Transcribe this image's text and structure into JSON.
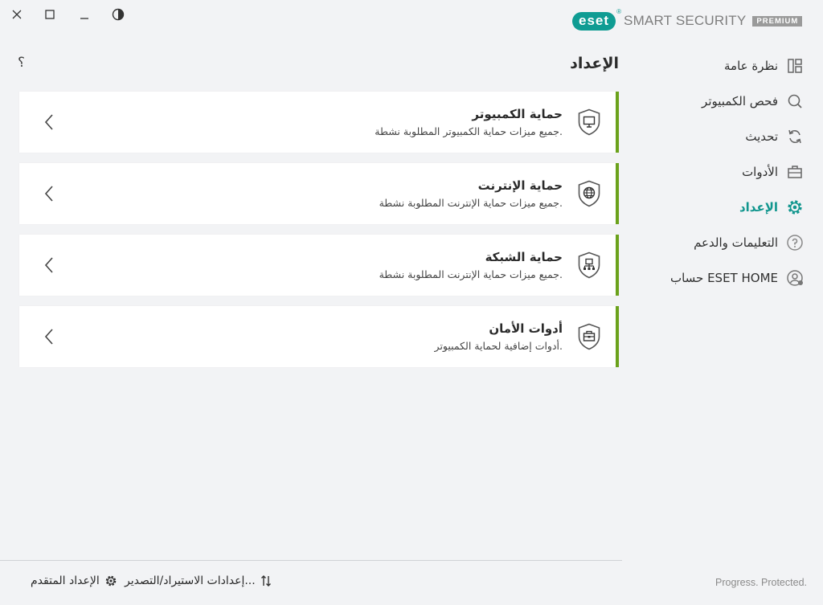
{
  "window": {
    "close_label": "close",
    "maximize_label": "maximize",
    "minimize_label": "minimize",
    "theme_label": "theme"
  },
  "brand": {
    "logo_text": "eset",
    "product": "SMART SECURITY",
    "edition": "PREMIUM",
    "accent_color": "#0f9c93"
  },
  "sidebar": {
    "items": [
      {
        "label": "نظرة عامة",
        "icon": "dashboard-icon"
      },
      {
        "label": "فحص الكمبيوتر",
        "icon": "search-icon"
      },
      {
        "label": "تحديث",
        "icon": "refresh-icon"
      },
      {
        "label": "الأدوات",
        "icon": "toolbox-icon"
      },
      {
        "label": "الإعداد",
        "icon": "gear-icon",
        "active": true
      },
      {
        "label": "التعليمات والدعم",
        "icon": "help-icon"
      },
      {
        "label": "حساب ESET HOME",
        "icon": "account-icon"
      }
    ]
  },
  "header": {
    "title": "الإعداد",
    "help": "؟"
  },
  "cards": [
    {
      "title": "حماية الكمبيوتر",
      "desc": "جميع ميزات حماية الكمبيوتر المطلوبة نشطة.",
      "icon": "monitor-shield-icon"
    },
    {
      "title": "حماية الإنترنت",
      "desc": "جميع ميزات حماية الإنترنت المطلوبة نشطة.",
      "icon": "globe-shield-icon"
    },
    {
      "title": "حماية الشبكة",
      "desc": "جميع ميزات حماية الإنترنت المطلوبة نشطة.",
      "icon": "network-shield-icon"
    },
    {
      "title": "أدوات الأمان",
      "desc": "أدوات إضافية لحماية الكمبيوتر.",
      "icon": "toolbox-shield-icon"
    }
  ],
  "status_color": "#6ba21c",
  "footer": {
    "import_export": "إعدادات الاستيراد/التصدير...",
    "advanced": "الإعداد المتقدم",
    "slogan": "Progress. Protected."
  }
}
